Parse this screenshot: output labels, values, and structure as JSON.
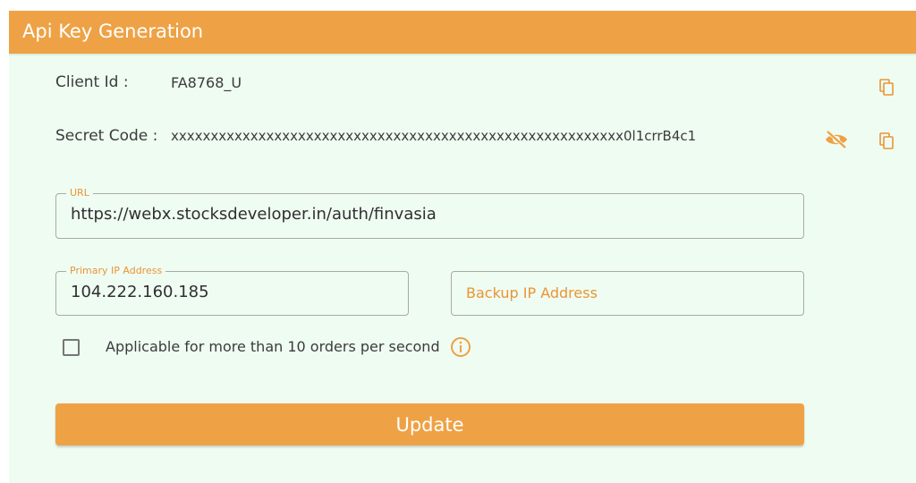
{
  "header": {
    "title": "Api Key Generation"
  },
  "client": {
    "label": "Client Id :",
    "value": "FA8768_U",
    "copy_icon": "copy-icon"
  },
  "secret": {
    "label": "Secret Code :",
    "value": "xxxxxxxxxxxxxxxxxxxxxxxxxxxxxxxxxxxxxxxxxxxxxxxxxxxxxxxxx0l1crrB4c1",
    "visibility_icon": "eye-off-icon",
    "copy_icon": "copy-icon"
  },
  "url_field": {
    "legend": "URL",
    "value": "https://webx.stocksdeveloper.in/auth/finvasia"
  },
  "primary_ip": {
    "legend": "Primary IP Address",
    "value": "104.222.160.185"
  },
  "backup_ip": {
    "placeholder": "Backup IP Address"
  },
  "orders_option": {
    "label": "Applicable for more than 10 orders per second",
    "checked": false,
    "info_icon": "info-icon"
  },
  "update_button": {
    "label": "Update"
  },
  "colors": {
    "accent": "#eea245",
    "accent_text": "#e99534",
    "panel_background": "#effcf2",
    "text": "#3b3b3b",
    "border": "#a9aaa9"
  }
}
